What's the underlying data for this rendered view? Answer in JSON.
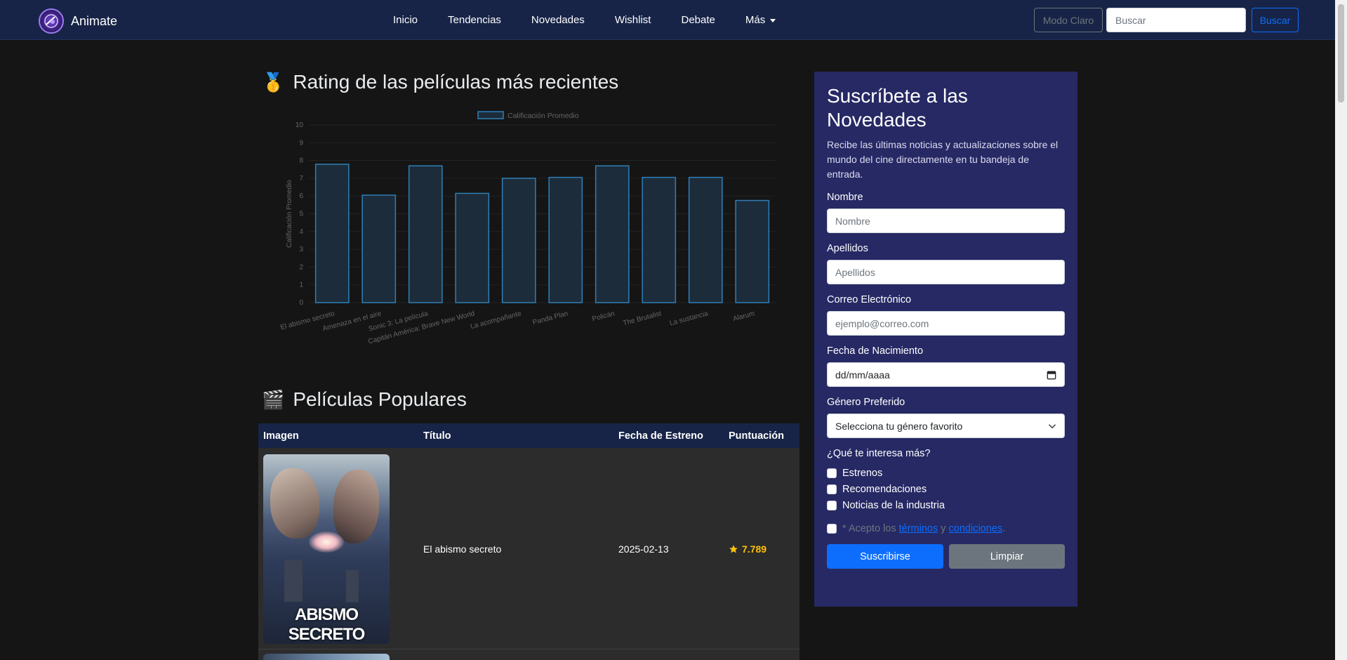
{
  "navbar": {
    "brand": "Animate",
    "links": [
      "Inicio",
      "Tendencias",
      "Novedades",
      "Wishlist",
      "Debate",
      "Más"
    ],
    "mode_button": "Modo Claro",
    "search_placeholder": "Buscar",
    "search_button": "Buscar"
  },
  "rating_section": {
    "emoji": "🥇",
    "title": "Rating de las películas más recientes"
  },
  "chart_data": {
    "type": "bar",
    "legend": [
      "Calificación Promedio"
    ],
    "ylabel": "Calificación Promedio",
    "xlabel": "",
    "ylim": [
      0,
      10
    ],
    "y_ticks": [
      "0",
      "1",
      "2",
      "3",
      "4",
      "5",
      "6",
      "7",
      "8",
      "9",
      "10"
    ],
    "categories": [
      "El abismo secreto",
      "Amenaza en el aire",
      "Sonic 3: La película",
      "Capitán América: Brave New World",
      "La acompañante",
      "Panda Plan",
      "Policán",
      "The Brutalist",
      "La sustancia",
      "Alarum"
    ],
    "series": [
      {
        "name": "Calificación Promedio",
        "values": [
          7.789,
          6.05,
          7.7,
          6.15,
          7.0,
          7.05,
          7.7,
          7.05,
          7.05,
          5.75
        ]
      }
    ],
    "bar_fill": "#1d2c3a",
    "bar_stroke": "#2f7fb8",
    "text_color": "#666666"
  },
  "popular_section": {
    "emoji": "🎬",
    "title": "Películas Populares",
    "columns": [
      "Imagen",
      "Título",
      "Fecha de Estreno",
      "Puntuación"
    ],
    "rows": [
      {
        "title": "El abismo secreto",
        "date": "2025-02-13",
        "score": "7.789",
        "poster_text": "ABISMO SECRETO"
      }
    ]
  },
  "subscribe": {
    "title": "Suscríbete a las Novedades",
    "description": "Recibe las últimas noticias y actualizaciones sobre el mundo del cine directamente en tu bandeja de entrada.",
    "fields": {
      "nombre_label": "Nombre",
      "nombre_placeholder": "Nombre",
      "apellidos_label": "Apellidos",
      "apellidos_placeholder": "Apellidos",
      "email_label": "Correo Electrónico",
      "email_placeholder": "ejemplo@correo.com",
      "fecha_label": "Fecha de Nacimiento",
      "fecha_placeholder": "dd/mm/aaaa",
      "genero_label": "Género Preferido",
      "genero_selected": "Selecciona tu género favorito"
    },
    "interest_label": "¿Qué te interesa más?",
    "interests": [
      "Estrenos",
      "Recomendaciones",
      "Noticias de la industria"
    ],
    "terms_prefix": "* Acepto los",
    "terms_link": "términos",
    "terms_and": "y",
    "conditions_link": "condiciones",
    "terms_suffix": ".",
    "submit_button": "Suscribirse",
    "clear_button": "Limpiar"
  }
}
